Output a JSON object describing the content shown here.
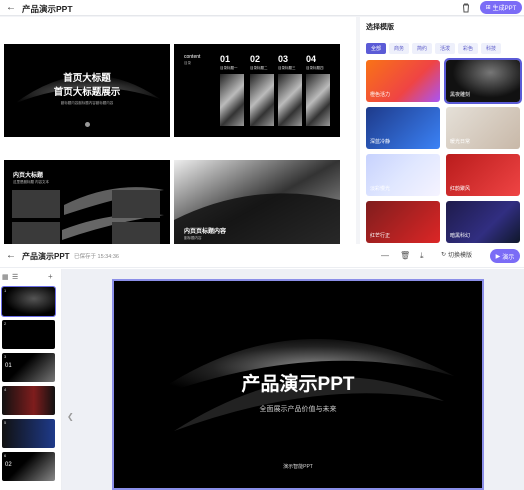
{
  "top": {
    "title": "产品演示PPT",
    "generate_label": "生成PPT",
    "slides": {
      "s1": {
        "title1": "首页大标题",
        "title2": "首页大标题展示",
        "subtitle": "副标题内容副标题内容副标题内容"
      },
      "s2": {
        "title": "content",
        "subtitle": "目录",
        "items": [
          {
            "num": "01",
            "label": "目录标题一"
          },
          {
            "num": "02",
            "label": "目录标题二"
          },
          {
            "num": "03",
            "label": "目录标题三"
          },
          {
            "num": "04",
            "label": "目录标题四"
          }
        ]
      },
      "s3": {
        "title": "内页大标题",
        "subtitle": "这里是副标题  内容文本"
      },
      "s4": {
        "title": "内页页标题内容",
        "subtitle": "副标题内容"
      }
    }
  },
  "template_panel": {
    "title": "选择模版",
    "filters": [
      "全部",
      "商务",
      "简约",
      "活泼",
      "彩色",
      "科技"
    ],
    "templates": [
      {
        "label": "橙色活力"
      },
      {
        "label": "黑夜雕刻"
      },
      {
        "label": "深蓝冷静"
      },
      {
        "label": "暖光日常"
      },
      {
        "label": "淡彩慢光"
      },
      {
        "label": "红韵聚风"
      },
      {
        "label": "红芒行正"
      },
      {
        "label": "暗黑科幻"
      }
    ]
  },
  "editor": {
    "title": "产品演示PPT",
    "saved": "已保存于 15:34:36",
    "switch_label": "切换模版",
    "play_label": "演示",
    "slide_numbers": [
      "1",
      "2",
      "3",
      "4",
      "5",
      "6"
    ],
    "thumb_texts": {
      "t3": "01",
      "t6": "02"
    },
    "main": {
      "title": "产品演示PPT",
      "subtitle": "全面展示产品价值与未来",
      "footer": "演示智能PPT"
    }
  },
  "colors": {
    "accent": "#7b6cf6",
    "filter_active": "#5b5bd6"
  }
}
